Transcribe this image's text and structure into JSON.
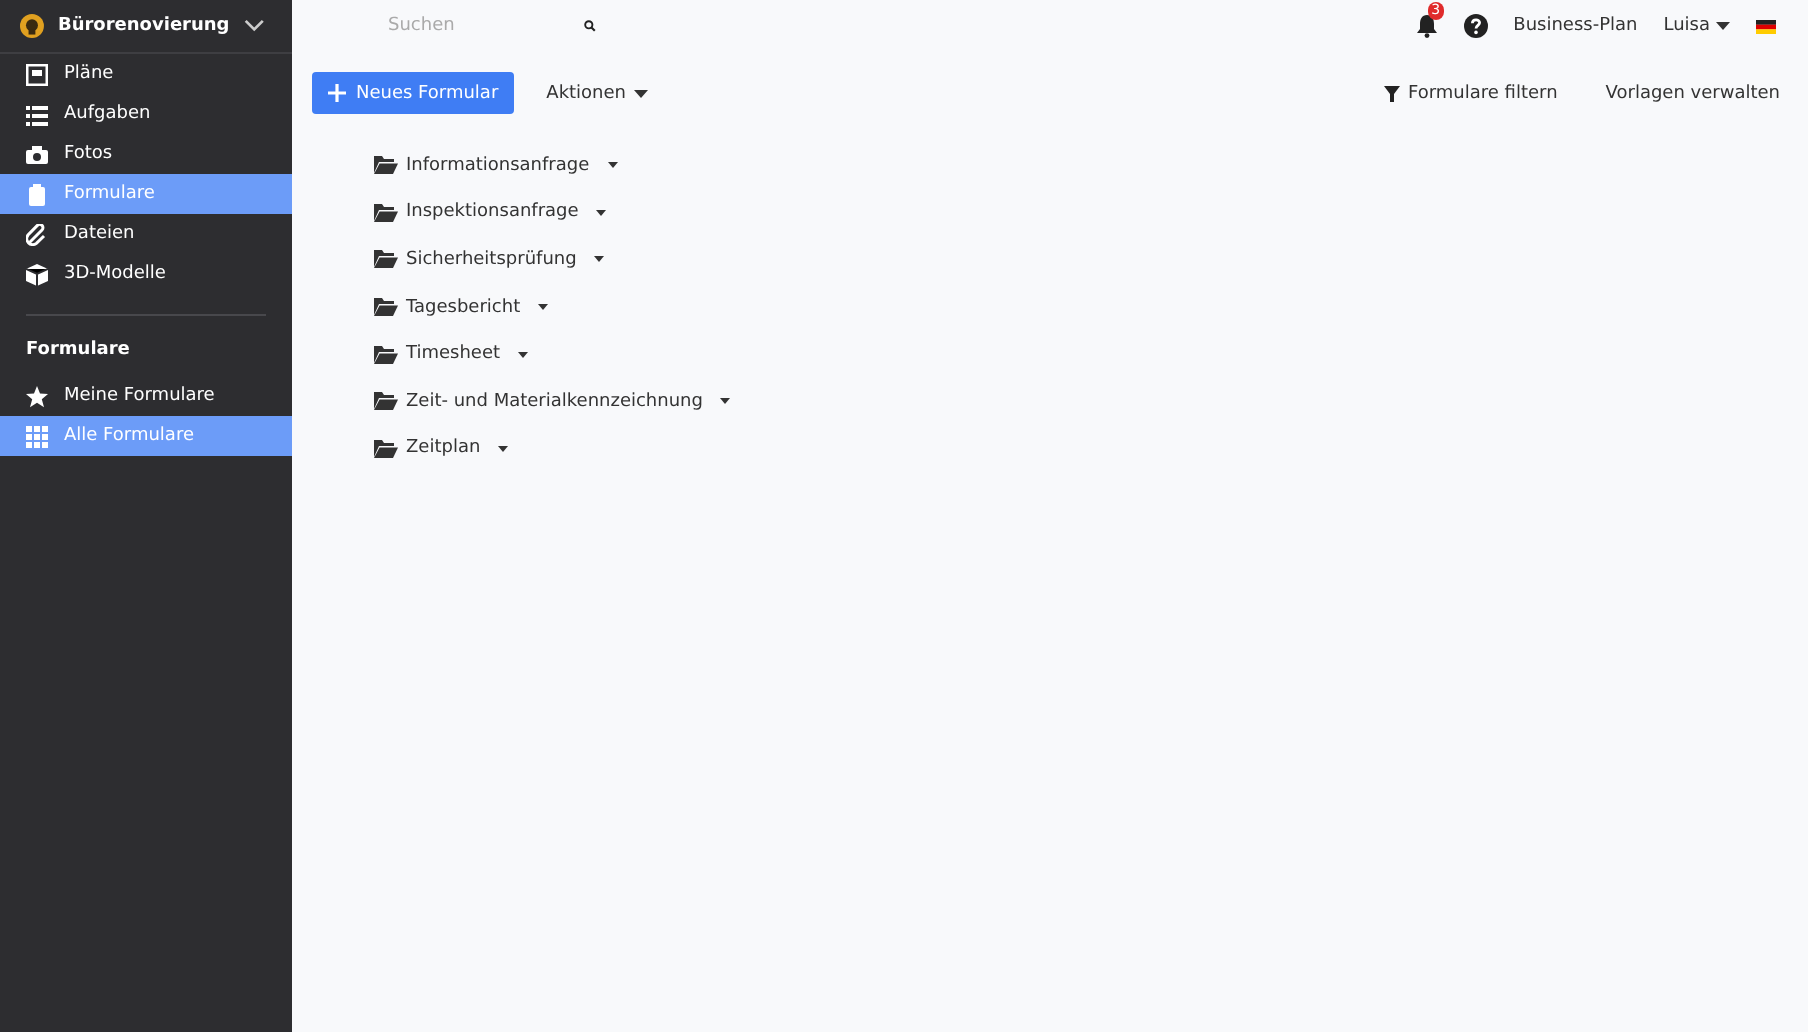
{
  "project": {
    "name": "Bürorenovierung"
  },
  "nav": [
    {
      "label": "Pläne",
      "selected": false
    },
    {
      "label": "Aufgaben",
      "selected": false
    },
    {
      "label": "Fotos",
      "selected": false
    },
    {
      "label": "Formulare",
      "selected": true
    },
    {
      "label": "Dateien",
      "selected": false
    },
    {
      "label": "3D-Modelle",
      "selected": false
    }
  ],
  "section": {
    "title": "Formulare",
    "items": [
      {
        "label": "Meine Formulare",
        "selected": false
      },
      {
        "label": "Alle Formulare",
        "selected": true
      }
    ]
  },
  "topbar": {
    "search": {
      "placeholder": "Suchen"
    },
    "notifications": "3",
    "plan": "Business-Plan",
    "user": "Luisa"
  },
  "toolbar": {
    "new_button": "Neues Formular",
    "actions": "Aktionen",
    "filter": "Formulare filtern",
    "templates": "Vorlagen verwalten"
  },
  "folders": [
    {
      "name": "Informationsanfrage"
    },
    {
      "name": "Inspektionsanfrage"
    },
    {
      "name": "Sicherheitsprüfung"
    },
    {
      "name": "Tagesbericht"
    },
    {
      "name": "Timesheet"
    },
    {
      "name": "Zeit- und Materialkennzeichnung"
    },
    {
      "name": "Zeitplan"
    }
  ]
}
